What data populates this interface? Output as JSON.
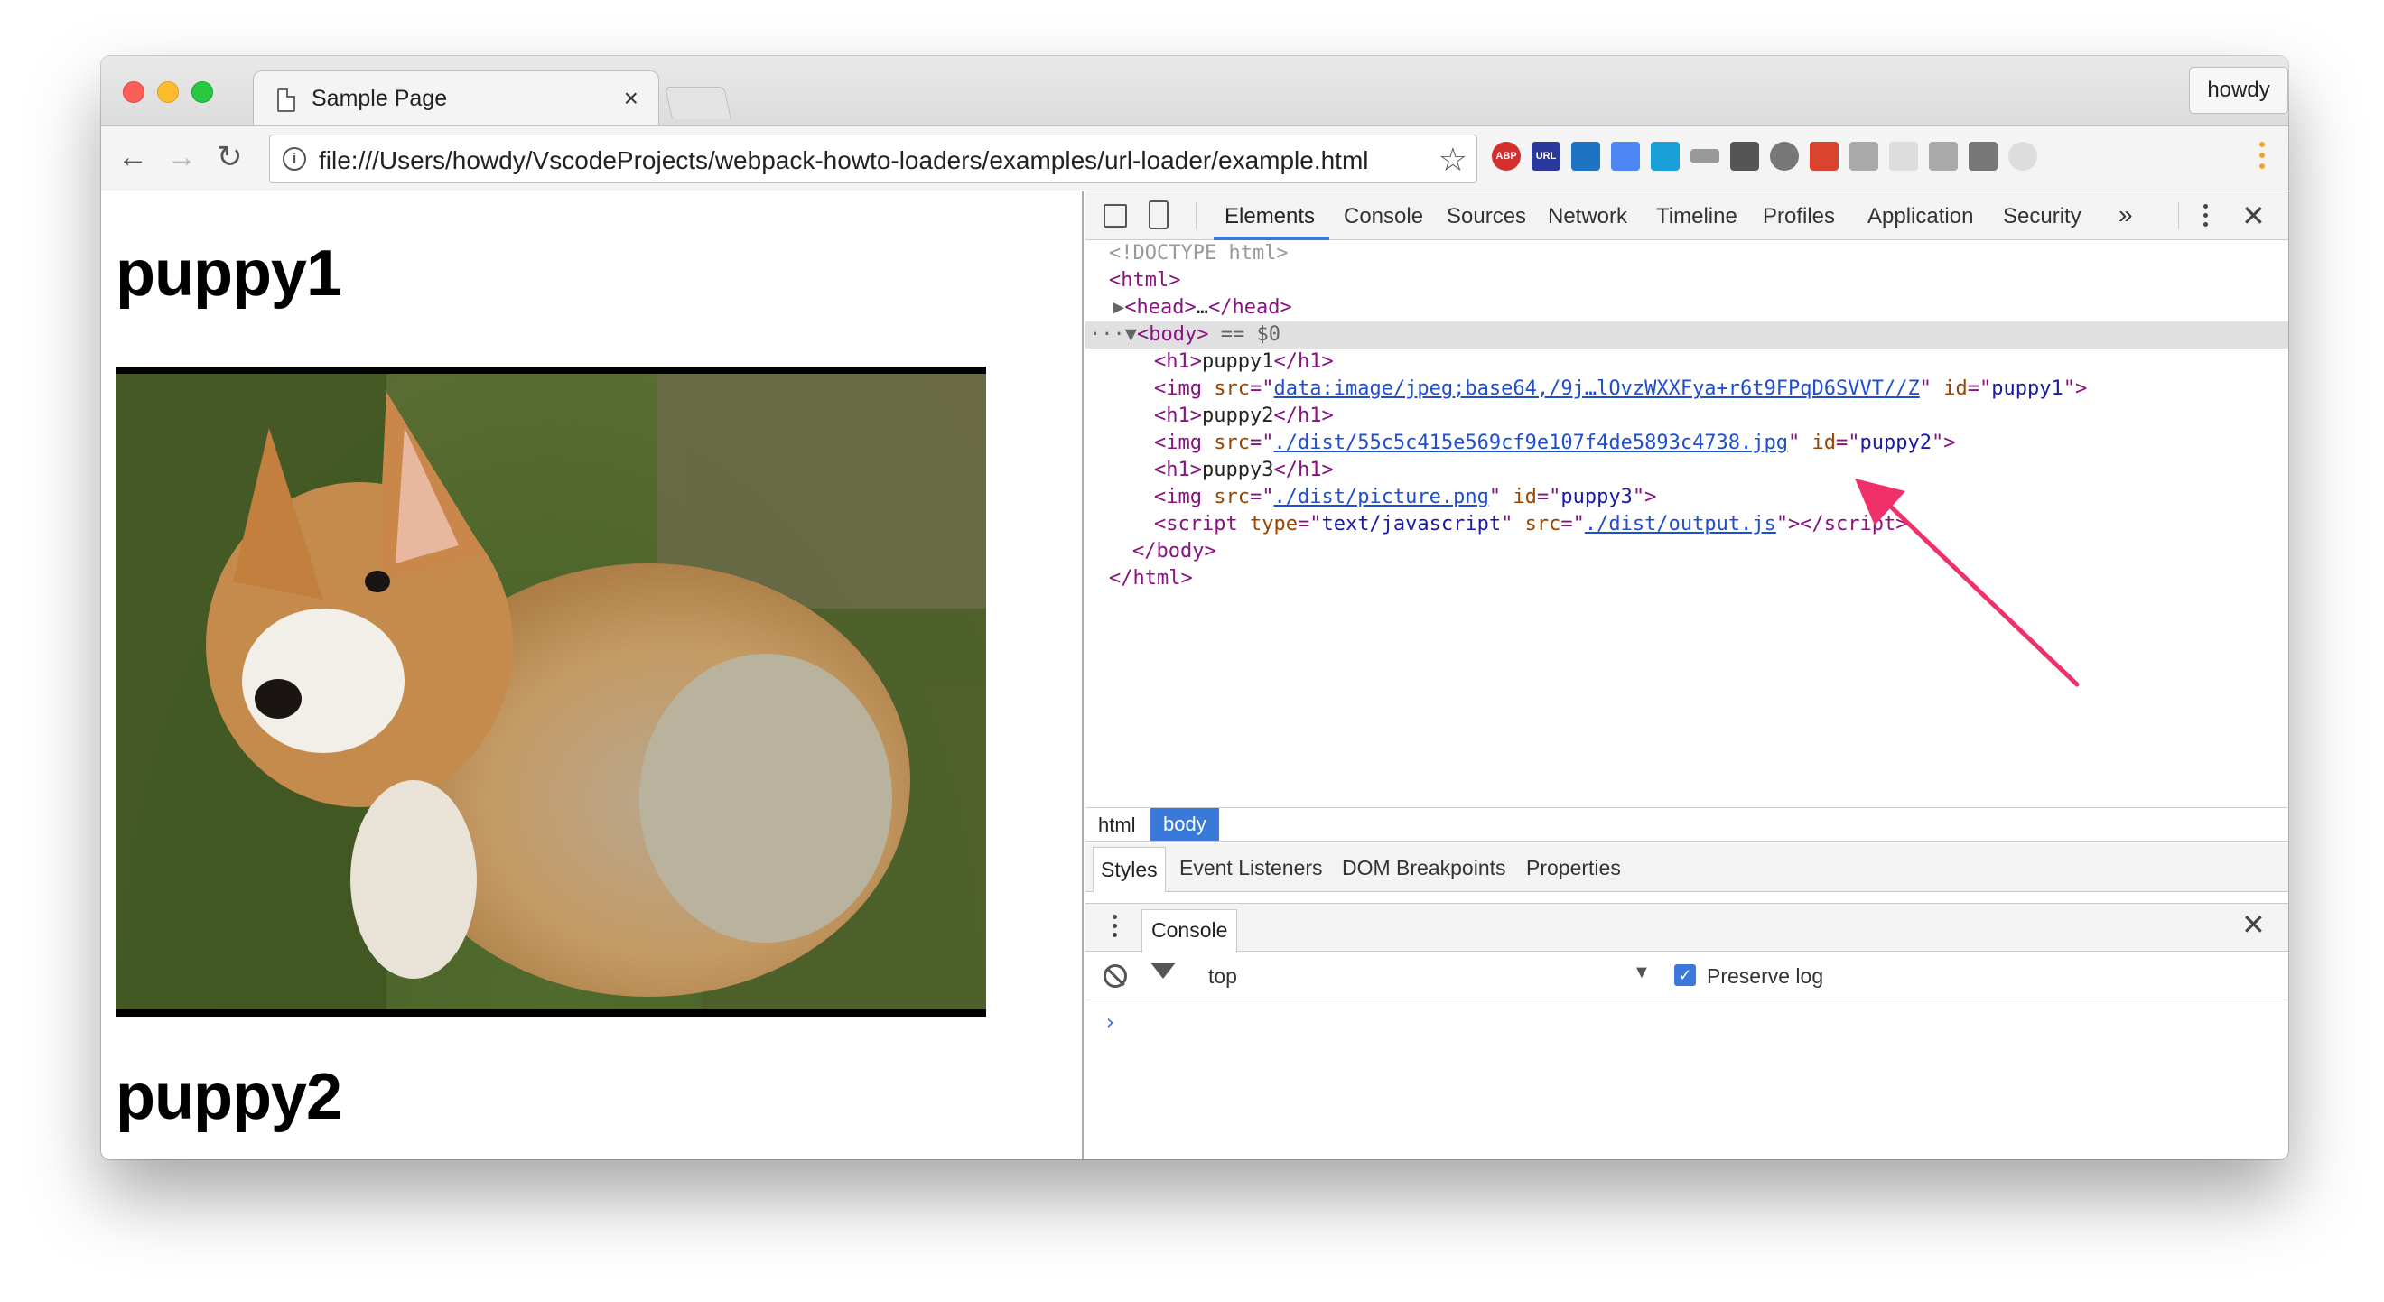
{
  "browser": {
    "tab_title": "Sample Page",
    "tab_close": "×",
    "profile_name": "howdy",
    "url": "file:///Users/howdy/VscodeProjects/webpack-howto-loaders/examples/url-loader/example.html",
    "extensions": [
      "ABP",
      "URL"
    ]
  },
  "page": {
    "heading1": "puppy1",
    "heading2": "puppy2"
  },
  "devtools": {
    "tabs": [
      "Elements",
      "Console",
      "Sources",
      "Network",
      "Timeline",
      "Profiles",
      "Application",
      "Security"
    ],
    "more": "»",
    "dom": {
      "doctype": "<!DOCTYPE html>",
      "html_open": "<html>",
      "head_open": "<head>",
      "head_ellipsis": "…",
      "head_close": "</head>",
      "body_open": "<body>",
      "body_selected_marker": "== $0",
      "h1_1": "puppy1",
      "img1_src": "data:image/jpeg;base64,/9j…lOvzWXXFya+r6t9FPqD6SVVT//Z",
      "img1_id": "puppy1",
      "h1_2": "puppy2",
      "img2_src": "./dist/55c5c415e569cf9e107f4de5893c4738.jpg",
      "img2_id": "puppy2",
      "h1_3": "puppy3",
      "img3_src": "./dist/picture.png",
      "img3_id": "puppy3",
      "script_type": "text/javascript",
      "script_src": "./dist/output.js",
      "body_close": "</body>",
      "html_close": "</html>"
    },
    "breadcrumbs": [
      "html",
      "body"
    ],
    "sidebar_tabs": [
      "Styles",
      "Event Listeners",
      "DOM Breakpoints",
      "Properties"
    ],
    "drawer": {
      "tab": "Console",
      "context": "top",
      "preserve_log_label": "Preserve log",
      "preserve_log_checked": true,
      "prompt": "›"
    }
  },
  "colors": {
    "accent": "#3879d9",
    "tag": "#881280",
    "attr_name": "#994500",
    "attr_value": "#1a1aa6",
    "annotation_arrow": "#f0306a"
  }
}
